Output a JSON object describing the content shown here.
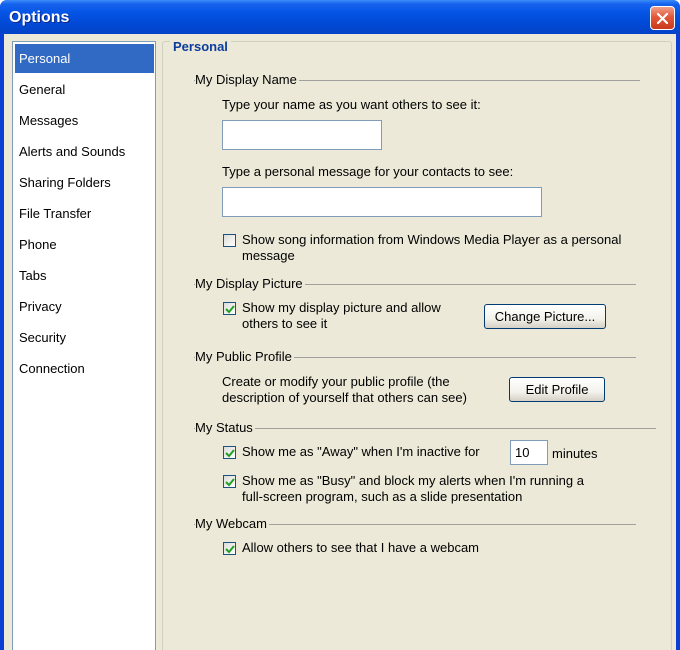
{
  "window": {
    "title": "Options"
  },
  "sidebar": {
    "items": [
      {
        "label": "Personal",
        "selected": true
      },
      {
        "label": "General"
      },
      {
        "label": "Messages"
      },
      {
        "label": "Alerts and Sounds"
      },
      {
        "label": "Sharing Folders"
      },
      {
        "label": "File Transfer"
      },
      {
        "label": "Phone"
      },
      {
        "label": "Tabs"
      },
      {
        "label": "Privacy"
      },
      {
        "label": "Security"
      },
      {
        "label": "Connection"
      }
    ]
  },
  "panel": {
    "title": "Personal",
    "display_name": {
      "heading": "My Display Name",
      "name_label": "Type your name as you want others to see it:",
      "name_value": "",
      "message_label": "Type a personal message for your contacts to see:",
      "message_value": "",
      "song_info": {
        "label_line1": "Show song information from Windows Media Player as a personal",
        "label_line2": "message",
        "checked": false
      }
    },
    "display_picture": {
      "heading": "My Display Picture",
      "show_picture": {
        "label_line1": "Show my display picture and allow",
        "label_line2": "others to see it",
        "checked": true
      },
      "change_button": "Change Picture..."
    },
    "public_profile": {
      "heading": "My Public Profile",
      "desc_line1": "Create or modify your public profile (the",
      "desc_line2": "description of yourself that others can see)",
      "edit_button": "Edit Profile"
    },
    "status": {
      "heading": "My Status",
      "away": {
        "label": "Show me as \"Away\" when I'm inactive for",
        "checked": true,
        "minutes_value": "10",
        "minutes_label": "minutes"
      },
      "busy": {
        "label_line1": "Show me as \"Busy\" and block my alerts when I'm running a",
        "label_line2": "full-screen program, such as a slide presentation",
        "checked": true
      }
    },
    "webcam": {
      "heading": "My Webcam",
      "allow": {
        "label": "Allow others to see that I have a webcam",
        "checked": true
      }
    }
  },
  "colors": {
    "titlebar": "#0553e3",
    "selection": "#316ac5",
    "panel_title": "#0b3c9e",
    "check": "#21a121",
    "close": "#e2573a"
  }
}
